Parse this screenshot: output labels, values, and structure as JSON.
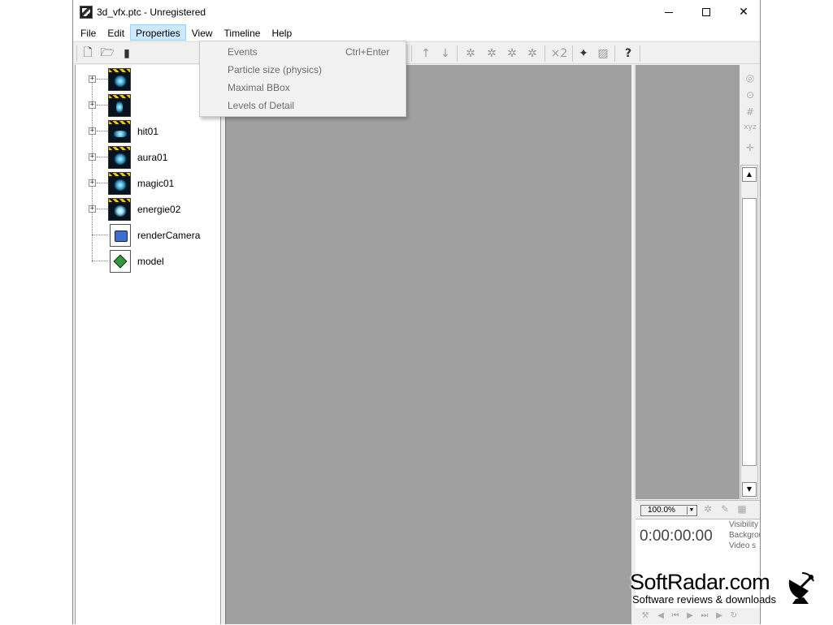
{
  "window": {
    "title": "3d_vfx.ptc - Unregistered"
  },
  "menubar": {
    "items": [
      "File",
      "Edit",
      "Properties",
      "View",
      "Timeline",
      "Help"
    ]
  },
  "properties_menu": {
    "items": [
      {
        "label": "Events",
        "shortcut": "Ctrl+Enter"
      },
      {
        "label": "Particle size (physics)",
        "shortcut": ""
      },
      {
        "label": "Maximal BBox",
        "shortcut": ""
      },
      {
        "label": "Levels of Detail",
        "shortcut": ""
      }
    ]
  },
  "tree": {
    "items": [
      {
        "label": "",
        "type": "effect"
      },
      {
        "label": "",
        "type": "effect"
      },
      {
        "label": "hit01",
        "type": "effect"
      },
      {
        "label": "aura01",
        "type": "effect"
      },
      {
        "label": "magic01",
        "type": "effect"
      },
      {
        "label": "energie02",
        "type": "effect"
      },
      {
        "label": "renderCamera",
        "type": "camera"
      },
      {
        "label": "model",
        "type": "model"
      }
    ]
  },
  "preview": {
    "zoom": "100.0%",
    "timecode": "0:00:00:00",
    "side_labels": [
      "Visibility",
      "Background",
      "Video s"
    ]
  },
  "watermark": {
    "title": "SoftRadar.com",
    "subtitle": "Software reviews & downloads"
  },
  "toolbar_help_icon": "?"
}
